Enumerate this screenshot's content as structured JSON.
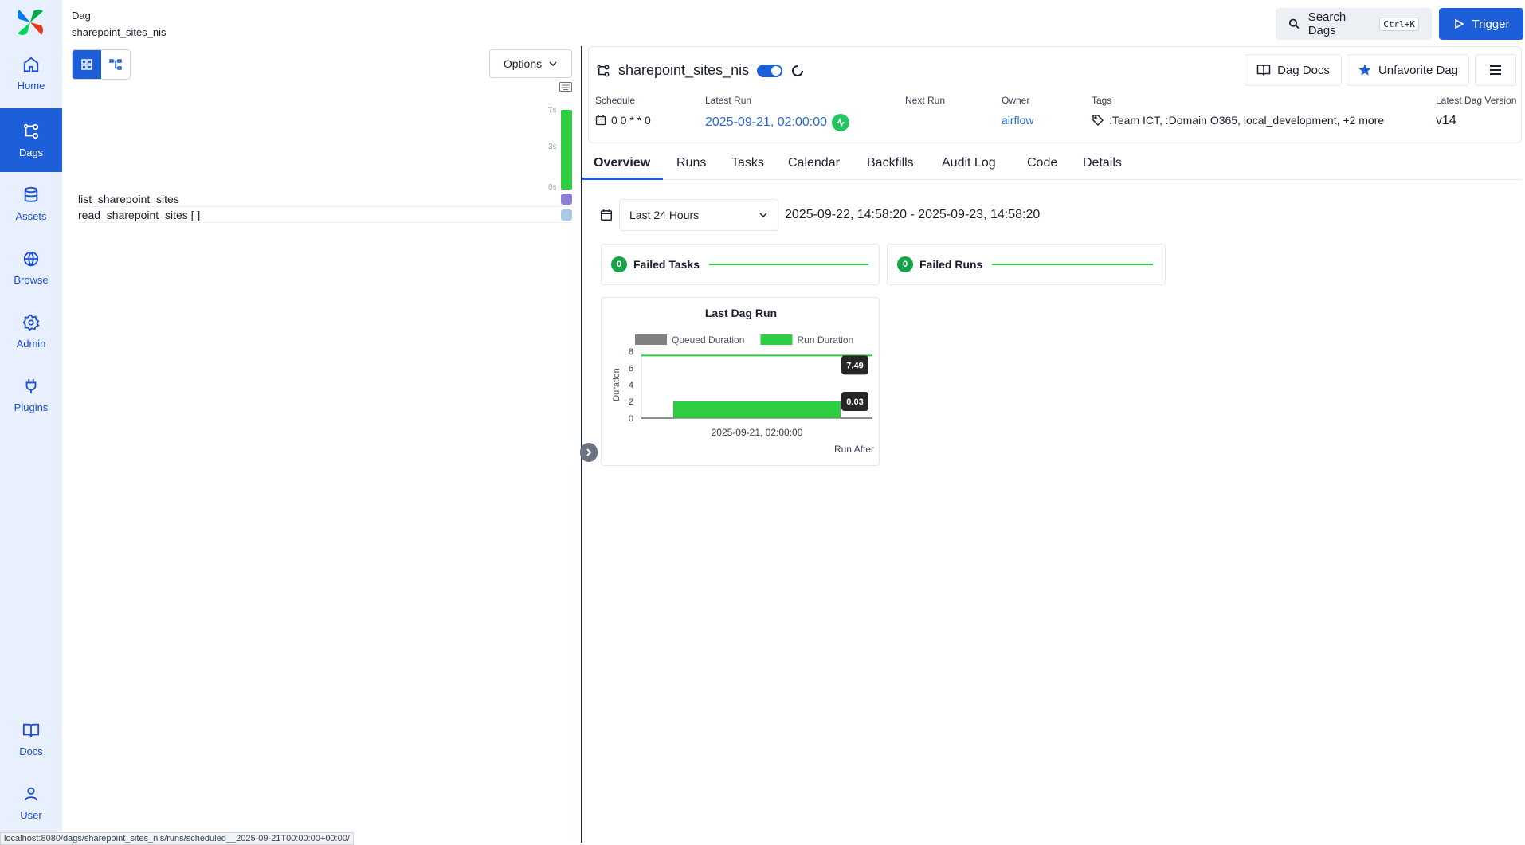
{
  "sidebar": {
    "items": [
      {
        "label": "Home",
        "icon": "home-icon"
      },
      {
        "label": "Dags",
        "icon": "dags-icon"
      },
      {
        "label": "Assets",
        "icon": "database-icon"
      },
      {
        "label": "Browse",
        "icon": "globe-icon"
      },
      {
        "label": "Admin",
        "icon": "gear-icon"
      },
      {
        "label": "Plugins",
        "icon": "plug-icon"
      },
      {
        "label": "Docs",
        "icon": "book-icon"
      },
      {
        "label": "User",
        "icon": "user-icon"
      }
    ]
  },
  "breadcrumb": {
    "label": "Dag",
    "value": "sharepoint_sites_nis"
  },
  "left_panel": {
    "options_label": "Options",
    "axis": {
      "top": "7s",
      "mid": "3s",
      "bottom": "0s"
    },
    "tasks": [
      {
        "name": "list_sharepoint_sites",
        "state_color": "#8b7fd6"
      },
      {
        "name": "read_sharepoint_sites [ ]",
        "state_color": "#a9cbe8"
      }
    ]
  },
  "status_bar": {
    "url": "localhost:8080/dags/sharepoint_sites_nis/runs/scheduled__2025-09-21T00:00:00+00:00/"
  },
  "top_actions": {
    "search_label": "Search Dags",
    "search_shortcut": "Ctrl+K",
    "trigger_label": "Trigger"
  },
  "dag": {
    "title": "sharepoint_sites_nis",
    "docs_label": "Dag Docs",
    "favorite_label": "Unfavorite Dag",
    "meta": {
      "schedule_label": "Schedule",
      "schedule_value": "0 0 * * 0",
      "latest_run_label": "Latest Run",
      "latest_run_value": "2025-09-21, 02:00:00",
      "next_run_label": "Next Run",
      "owner_label": "Owner",
      "owner_value": "airflow",
      "tags_label": "Tags",
      "tags_value": ":Team ICT, :Domain O365, local_development, +2 more",
      "version_label": "Latest Dag Version",
      "version_value": "v14"
    }
  },
  "tabs": [
    "Overview",
    "Runs",
    "Tasks",
    "Calendar",
    "Backfills",
    "Audit Log",
    "Code",
    "Details"
  ],
  "overview": {
    "range_label": "Last 24 Hours",
    "range_text": "2025-09-22, 14:58:20 - 2025-09-23, 14:58:20",
    "failed_tasks": {
      "count": "0",
      "label": "Failed Tasks"
    },
    "failed_runs": {
      "count": "0",
      "label": "Failed Runs"
    }
  },
  "colors": {
    "accent": "#1d5fd8",
    "success": "#2ecc40",
    "queued": "#808080"
  },
  "chart_data": {
    "type": "bar",
    "title": "Last Dag Run",
    "categories": [
      "2025-09-21, 02:00:00"
    ],
    "series": [
      {
        "name": "Queued Duration",
        "values": [
          0.03
        ],
        "color": "#808080"
      },
      {
        "name": "Run Duration",
        "values": [
          7.49
        ],
        "color": "#2ecc40"
      }
    ],
    "annotations": [
      "7.49",
      "0.03"
    ],
    "xlabel": "Run After",
    "ylabel": "Duration",
    "ylim": [
      0,
      8
    ],
    "yticks": [
      0,
      2,
      4,
      6,
      8
    ],
    "legend": "top",
    "grid": false
  }
}
